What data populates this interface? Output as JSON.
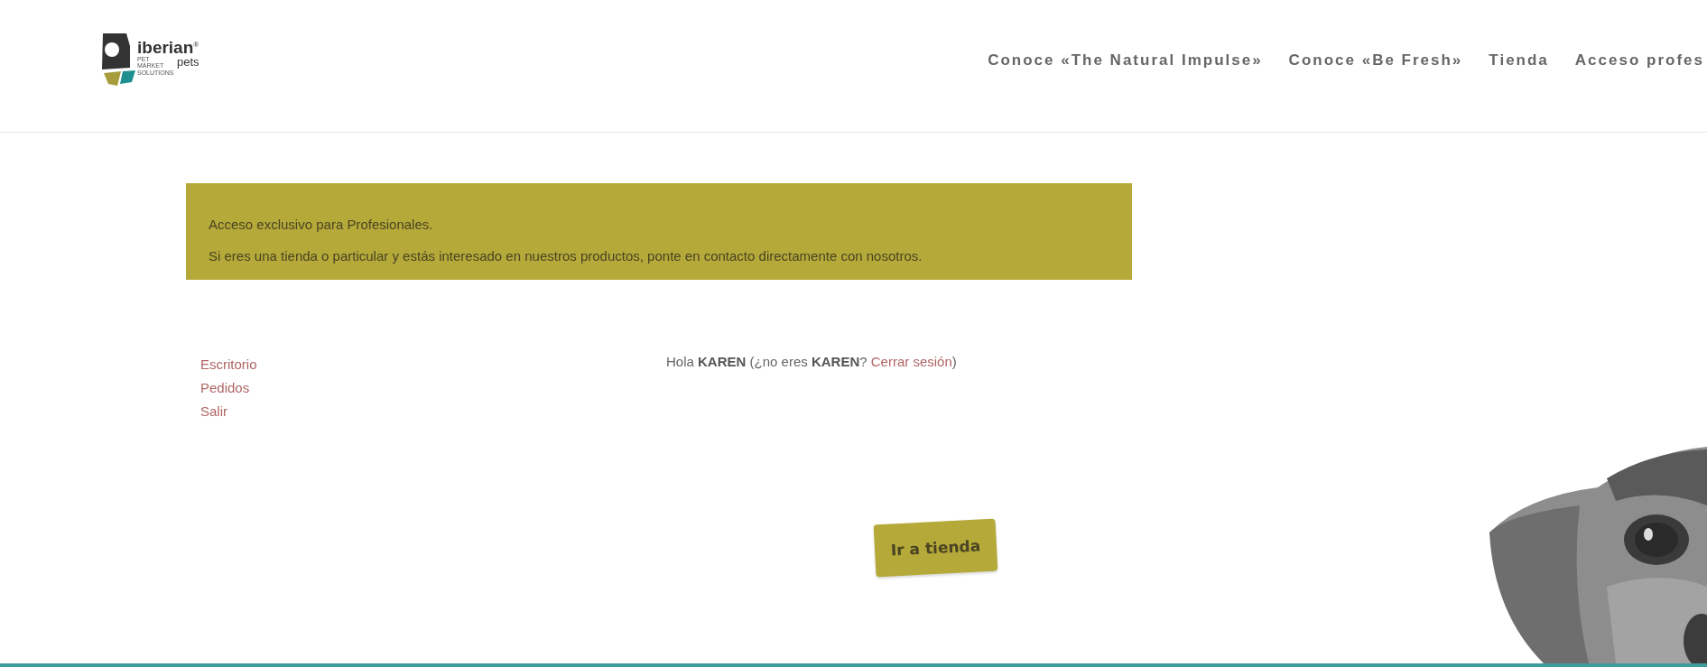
{
  "logo": {
    "wordmark": "iberian",
    "sub": "pets",
    "mark": "®",
    "tagline": "PET MARKET SOLUTIONS"
  },
  "nav": [
    {
      "label": "Conoce «The Natural Impulse»"
    },
    {
      "label": "Conoce «Be Fresh»"
    },
    {
      "label": "Tienda"
    },
    {
      "label": "Acceso profes"
    }
  ],
  "notice": [
    "Acceso exclusivo para Profesionales.",
    "Si eres una tienda o particular y estás interesado en nuestros productos, ponte en contacto directamente con nosotros."
  ],
  "account_menu": [
    {
      "label": "Escritorio"
    },
    {
      "label": "Pedidos"
    },
    {
      "label": "Salir"
    }
  ],
  "greeting": {
    "text": "Hola **KAREN** (¿no eres **KAREN**?",
    "link": "Cerrar sesión",
    "closing": ")"
  },
  "shop_button": "Ir a tienda",
  "photo": {
    "kind": "picture"
  }
}
